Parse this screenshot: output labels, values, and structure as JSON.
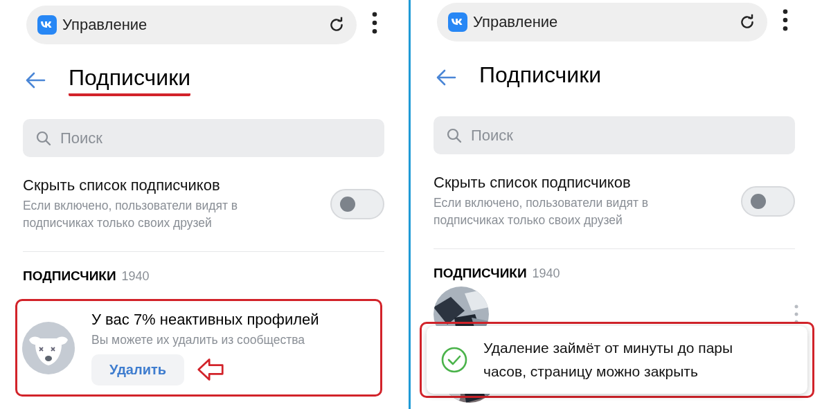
{
  "screens": [
    {
      "header": {
        "app_title": "Управление"
      },
      "page_title": "Подписчики",
      "title_underlined": true,
      "search": {
        "placeholder": "Поиск"
      },
      "setting": {
        "title": "Скрыть список подписчиков",
        "description": "Если включено, пользователи видят в подписчиках только своих друзей",
        "on": false
      },
      "section": {
        "label": "ПОДПИСЧИКИ",
        "count": "1940"
      },
      "banner": {
        "title": "У вас 7% неактивных профилей",
        "subtitle": "Вы можете их удалить из сообщества",
        "button": "Удалить",
        "highlighted": true,
        "arrow": true
      }
    },
    {
      "header": {
        "app_title": "Управление"
      },
      "page_title": "Подписчики",
      "title_underlined": false,
      "search": {
        "placeholder": "Поиск"
      },
      "setting": {
        "title": "Скрыть список подписчиков",
        "description": "Если включено, пользователи видят в подписчиках только своих друзей",
        "on": false
      },
      "section": {
        "label": "ПОДПИСЧИКИ",
        "count": "1940"
      },
      "toast": {
        "text": "Удаление займёт от минуты до пары часов, страницу можно закрыть",
        "highlighted": true
      }
    }
  ]
}
